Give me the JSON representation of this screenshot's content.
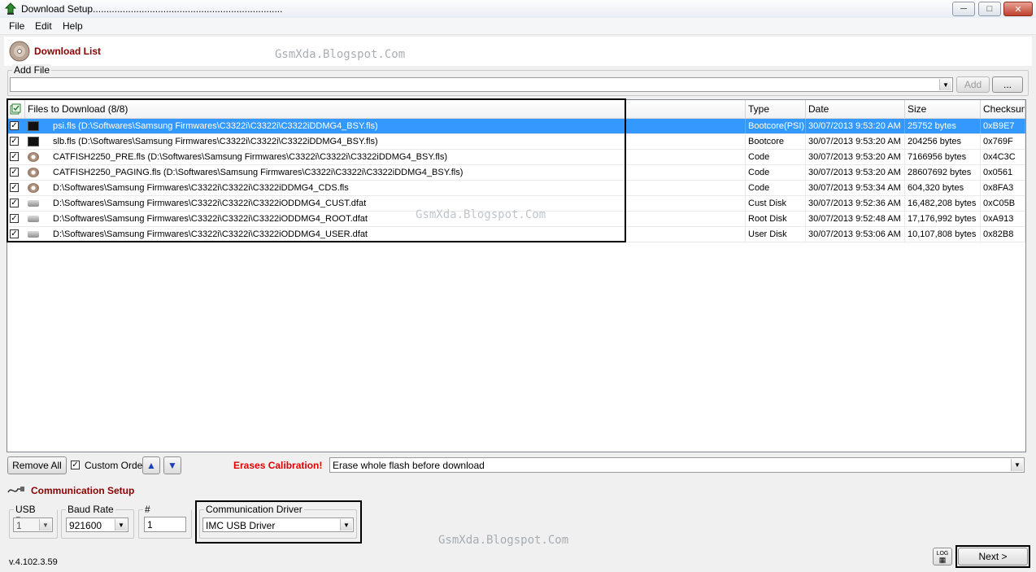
{
  "window": {
    "title": "Download Setup......................................................................"
  },
  "menu": {
    "file": "File",
    "edit": "Edit",
    "help": "Help"
  },
  "download_list": {
    "title": "Download List",
    "add_file_label": "Add File",
    "add_file_value": "",
    "add_button": "Add",
    "browse_button": "...",
    "columns": {
      "files": "Files to Download (8/8)",
      "type": "Type",
      "date": "Date",
      "size": "Size",
      "checksum": "Checksum"
    },
    "rows": [
      {
        "name": "psi.fls (D:\\Softwares\\Samsung Firmwares\\C3322i\\C3322i\\C3322iDDMG4_BSY.fls)",
        "type": "Bootcore(PSI)",
        "date": "30/07/2013 9:53:20 AM",
        "size": "25752 bytes",
        "checksum": "0xB9E7",
        "icon": "chip-icon"
      },
      {
        "name": "slb.fls (D:\\Softwares\\Samsung Firmwares\\C3322i\\C3322i\\C3322iDDMG4_BSY.fls)",
        "type": "Bootcore",
        "date": "30/07/2013 9:53:20 AM",
        "size": "204256 bytes",
        "checksum": "0x769F",
        "icon": "chip-icon"
      },
      {
        "name": "CATFISH2250_PRE.fls (D:\\Softwares\\Samsung Firmwares\\C3322i\\C3322i\\C3322iDDMG4_BSY.fls)",
        "type": "Code",
        "date": "30/07/2013 9:53:20 AM",
        "size": "7166956 bytes",
        "checksum": "0x4C3C",
        "icon": "disc-icon"
      },
      {
        "name": "CATFISH2250_PAGING.fls (D:\\Softwares\\Samsung Firmwares\\C3322i\\C3322i\\C3322iDDMG4_BSY.fls)",
        "type": "Code",
        "date": "30/07/2013 9:53:20 AM",
        "size": "28607692 bytes",
        "checksum": "0x0561",
        "icon": "disc-icon"
      },
      {
        "name": "D:\\Softwares\\Samsung Firmwares\\C3322i\\C3322i\\C3322iDDMG4_CDS.fls",
        "type": "Code",
        "date": "30/07/2013 9:53:34 AM",
        "size": "604,320 bytes",
        "checksum": "0x8FA3",
        "icon": "disc-icon"
      },
      {
        "name": "D:\\Softwares\\Samsung Firmwares\\C3322i\\C3322i\\C3322iODDMG4_CUST.dfat",
        "type": "Cust Disk",
        "date": "30/07/2013 9:52:36 AM",
        "size": "16,482,208 bytes",
        "checksum": "0xC05B",
        "icon": "drive-icon"
      },
      {
        "name": "D:\\Softwares\\Samsung Firmwares\\C3322i\\C3322i\\C3322iODDMG4_ROOT.dfat",
        "type": "Root Disk",
        "date": "30/07/2013 9:52:48 AM",
        "size": "17,176,992 bytes",
        "checksum": "0xA913",
        "icon": "drive-icon"
      },
      {
        "name": "D:\\Softwares\\Samsung Firmwares\\C3322i\\C3322i\\C3322iODDMG4_USER.dfat",
        "type": "User Disk",
        "date": "30/07/2013 9:53:06 AM",
        "size": "10,107,808 bytes",
        "checksum": "0x82B8",
        "icon": "drive-icon"
      }
    ],
    "remove_all": "Remove All",
    "custom_order": "Custom Order",
    "erases_calibration": "Erases Calibration!",
    "erase_option": "Erase whole flash before download"
  },
  "communication": {
    "title": "Communication Setup",
    "usb_port_label": "USB Port",
    "usb_port_value": "1",
    "baud_rate_label": "Baud Rate",
    "baud_rate_value": "921600",
    "channels_label": "# Channels",
    "channels_value": "1",
    "driver_label": "Communication Driver",
    "driver_value": "IMC USB Driver"
  },
  "footer": {
    "version": "v.4.102.3.59",
    "log_label": "LOG",
    "next_button": "Next >"
  },
  "watermark": "GsmXda.Blogspot.Com"
}
